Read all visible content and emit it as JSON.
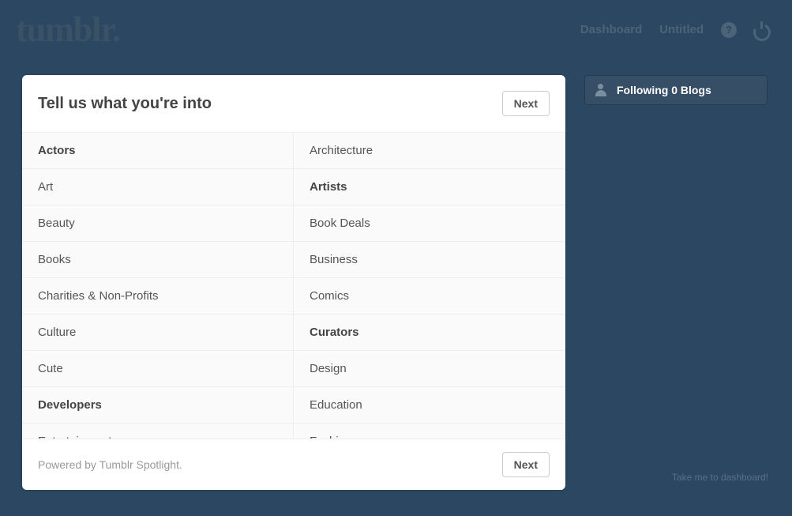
{
  "logo": "tumblr.",
  "nav": {
    "dashboard": "Dashboard",
    "untitled": "Untitled",
    "help_glyph": "?"
  },
  "card": {
    "title": "Tell us what you're into",
    "next_label": "Next",
    "footer_text": "Powered by Tumblr Spotlight.",
    "footer_next": "Next"
  },
  "categories": [
    {
      "label": "Actors",
      "bold": true
    },
    {
      "label": "Architecture",
      "bold": false
    },
    {
      "label": "Art",
      "bold": false
    },
    {
      "label": "Artists",
      "bold": true
    },
    {
      "label": "Beauty",
      "bold": false
    },
    {
      "label": "Book Deals",
      "bold": false
    },
    {
      "label": "Books",
      "bold": false
    },
    {
      "label": "Business",
      "bold": false
    },
    {
      "label": "Charities & Non-Profits",
      "bold": false
    },
    {
      "label": "Comics",
      "bold": false
    },
    {
      "label": "Culture",
      "bold": false
    },
    {
      "label": "Curators",
      "bold": true
    },
    {
      "label": "Cute",
      "bold": false
    },
    {
      "label": "Design",
      "bold": false
    },
    {
      "label": "Developers",
      "bold": true
    },
    {
      "label": "Education",
      "bold": false
    },
    {
      "label": "Entertainment",
      "bold": false
    },
    {
      "label": "Fashion",
      "bold": false
    }
  ],
  "sidebar": {
    "following_text": "Following 0 Blogs"
  },
  "dashboard_link": "Take me to dashboard!"
}
